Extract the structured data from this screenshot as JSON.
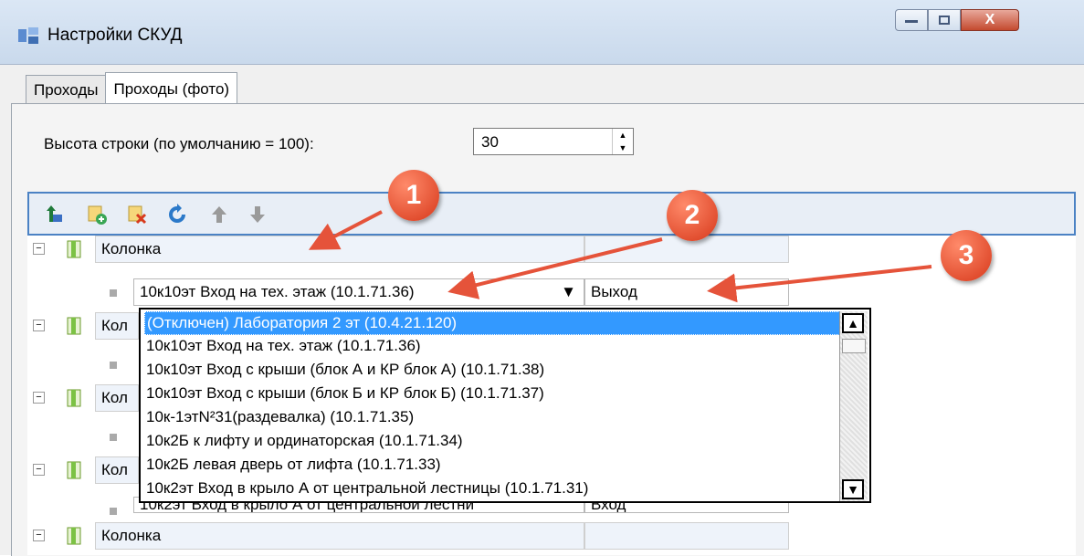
{
  "window": {
    "title": "Настройки СКУД",
    "close_glyph": "X"
  },
  "tabs": [
    {
      "label": "Проходы"
    },
    {
      "label": "Проходы (фото)"
    }
  ],
  "settings": {
    "row_height_label": "Высота строки (по умолчанию = 100):",
    "row_height_value": "30"
  },
  "toolbar": {
    "icons": [
      "up-level-icon",
      "add-icon",
      "delete-icon",
      "refresh-icon",
      "move-up-icon",
      "move-down-icon"
    ]
  },
  "tree": {
    "nodes": [
      {
        "label": "Колонка"
      },
      {
        "label": "Кол"
      },
      {
        "label": "Кол"
      },
      {
        "label": "Кол"
      },
      {
        "label": "Колонка"
      }
    ],
    "child_selected": "10к10эт Вход на тех. этаж (10.1.71.36)",
    "child_direction": "Выход",
    "child4_text": "10к2эт Вход в крыло А от центральной лестни",
    "child4_direction": "Вход"
  },
  "dropdown": {
    "items": [
      "(Отключен) Лаборатория 2 эт (10.4.21.120)",
      "10к10эт Вход на тех. этаж (10.1.71.36)",
      "10к10эт Вход с крыши (блок А и КР блок А)  (10.1.71.38)",
      "10к10эт Вход с крыши (блок Б и КР блок Б) (10.1.71.37)",
      "10к-1этN²31(раздевалка) (10.1.71.35)",
      "10к2Б к лифту и ординаторская (10.1.71.34)",
      "10к2Б левая дверь от лифта (10.1.71.33)",
      "10к2эт Вход в крыло А от центральной лестницы (10.1.71.31)"
    ],
    "selected_index": 0
  },
  "callouts": [
    "1",
    "2",
    "3"
  ]
}
